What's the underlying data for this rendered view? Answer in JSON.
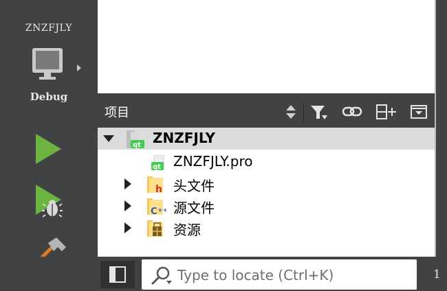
{
  "sidebar": {
    "project_name": "ZNZFJLY",
    "kit_label": "Debug",
    "icons": [
      "monitor-icon",
      "run-icon",
      "debug-run-icon",
      "build-icon"
    ]
  },
  "projects_pane": {
    "title": "项目",
    "toolbar_icons": [
      "sort-updown-icon",
      "filter-icon",
      "link-icon",
      "split-add-icon",
      "close-pane-icon"
    ]
  },
  "tree": [
    {
      "label": "ZNZFJLY",
      "icon": "qt-project-folder-icon",
      "expanded": true,
      "selected": true
    },
    {
      "label": "ZNZFJLY.pro",
      "icon": "qt-pro-file-icon"
    },
    {
      "label": "头文件",
      "icon": "header-folder-icon",
      "expanded": false
    },
    {
      "label": "源文件",
      "icon": "source-folder-icon",
      "expanded": false
    },
    {
      "label": "资源",
      "icon": "resource-folder-icon",
      "expanded": false
    }
  ],
  "bottom": {
    "locator_placeholder": "Type to locate (Ctrl+K)",
    "pane_number": "1"
  },
  "colors": {
    "sidebar_bg": "#404244",
    "run_green": "#6cb33f",
    "qt_green": "#41cd52",
    "hammer_orange": "#e07b24"
  }
}
